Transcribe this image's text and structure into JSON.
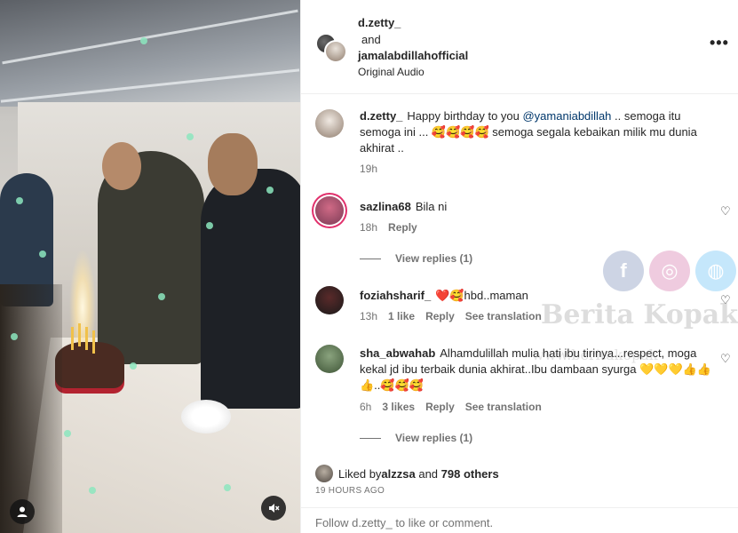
{
  "header": {
    "user1": "d.zetty_",
    "conjunction": "and",
    "user2": "jamalabdillahofficial",
    "audio": "Original Audio",
    "more_label": "•••"
  },
  "comments": [
    {
      "user": "d.zetty_",
      "text_before": "Happy birthday to you ",
      "mention": "@yamaniabdillah",
      "text_after": " .. semoga itu semoga ini ... 🥰🥰🥰🥰 semoga segala kebaikan milik mu dunia akhirat ..",
      "time": "19h"
    },
    {
      "user": "sazlina68",
      "text": "Bila ni",
      "time": "18h",
      "reply": "Reply",
      "view_replies": "View replies (1)"
    },
    {
      "user": "foziahsharif_",
      "text": "❤️🥰hbd..maman",
      "time": "13h",
      "likes": "1 like",
      "reply": "Reply",
      "translate": "See translation"
    },
    {
      "user": "sha_abwahab",
      "text": "Alhamdulillah mulia hati ibu tirinya...respect, moga kekal jd ibu terbaik dunia akhirat..Ibu dambaan syurga 💛💛💛👍👍👍..🥰🥰🥰",
      "time": "6h",
      "likes": "3 likes",
      "reply": "Reply",
      "translate": "See translation",
      "view_replies": "View replies (1)"
    }
  ],
  "liked": {
    "prefix": "Liked by ",
    "user": "alzzsa",
    "middle": " and ",
    "others": "798 others"
  },
  "posted": "19 HOURS AGO",
  "footer": "Follow d.zetty_ to like or comment.",
  "watermark": {
    "text": "Berita Kopak",
    "url": "www.beritakopak"
  },
  "icons": {
    "heart": "heart-outline-icon",
    "mute": "muted-speaker-icon",
    "user": "user-tag-icon"
  }
}
